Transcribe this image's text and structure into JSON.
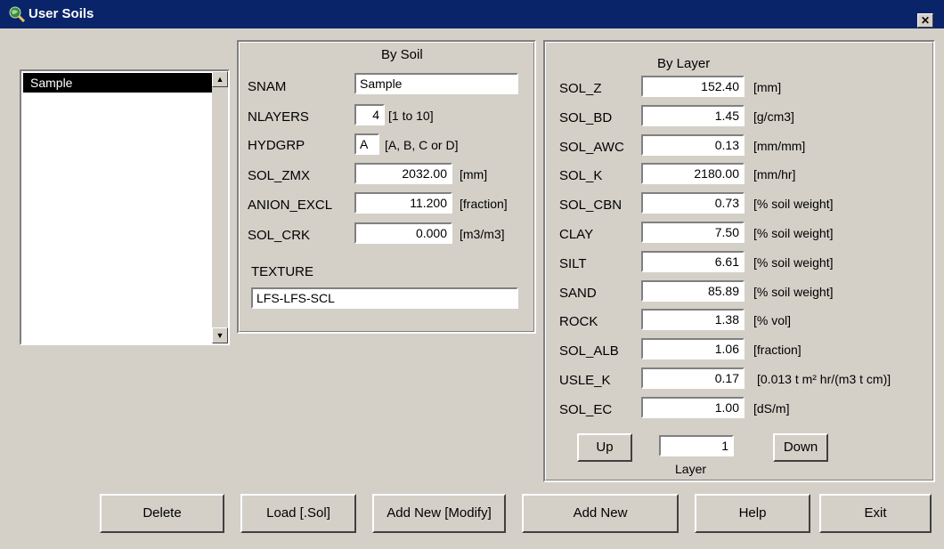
{
  "window": {
    "title": "User Soils"
  },
  "list": {
    "items": [
      "Sample"
    ]
  },
  "by_soil": {
    "title": "By Soil",
    "snam": {
      "label": "SNAM",
      "value": "Sample"
    },
    "nlayers": {
      "label": "NLAYERS",
      "value": "4",
      "hint": "[1 to 10]"
    },
    "hydgrp": {
      "label": "HYDGRP",
      "value": "A",
      "hint": "[A, B, C or D]"
    },
    "sol_zmx": {
      "label": "SOL_ZMX",
      "value": "2032.00",
      "unit": "[mm]"
    },
    "anion_excl": {
      "label": "ANION_EXCL",
      "value": "11.200",
      "unit": "[fraction]"
    },
    "sol_crk": {
      "label": "SOL_CRK",
      "value": "0.000",
      "unit": "[m3/m3]"
    },
    "texture": {
      "label": "TEXTURE",
      "value": "LFS-LFS-SCL"
    }
  },
  "by_layer": {
    "title": "By Layer",
    "rows": [
      {
        "label": "SOL_Z",
        "value": "152.40",
        "unit": "[mm]"
      },
      {
        "label": "SOL_BD",
        "value": "1.45",
        "unit": "[g/cm3]"
      },
      {
        "label": "SOL_AWC",
        "value": "0.13",
        "unit": "[mm/mm]"
      },
      {
        "label": "SOL_K",
        "value": "2180.00",
        "unit": "[mm/hr]"
      },
      {
        "label": "SOL_CBN",
        "value": "0.73",
        "unit": "[% soil weight]"
      },
      {
        "label": "CLAY",
        "value": "7.50",
        "unit": "[% soil weight]"
      },
      {
        "label": "SILT",
        "value": "6.61",
        "unit": "[% soil weight]"
      },
      {
        "label": "SAND",
        "value": "85.89",
        "unit": "[% soil weight]"
      },
      {
        "label": "ROCK",
        "value": "1.38",
        "unit": "[% vol]"
      },
      {
        "label": "SOL_ALB",
        "value": "1.06",
        "unit": "[fraction]"
      },
      {
        "label": "USLE_K",
        "value": "0.17",
        "unit": "[0.013 t m² hr/(m3 t cm)]"
      },
      {
        "label": "SOL_EC",
        "value": "1.00",
        "unit": "[dS/m]"
      }
    ],
    "up_label": "Up",
    "down_label": "Down",
    "layer_value": "1",
    "layer_caption": "Layer"
  },
  "buttons": {
    "delete": "Delete",
    "load": "Load [.Sol]",
    "add_modify": "Add New [Modify]",
    "add_new": "Add New",
    "help": "Help",
    "exit": "Exit"
  },
  "icons": {
    "app": "globe-magnifier-icon",
    "close": "close-icon"
  }
}
